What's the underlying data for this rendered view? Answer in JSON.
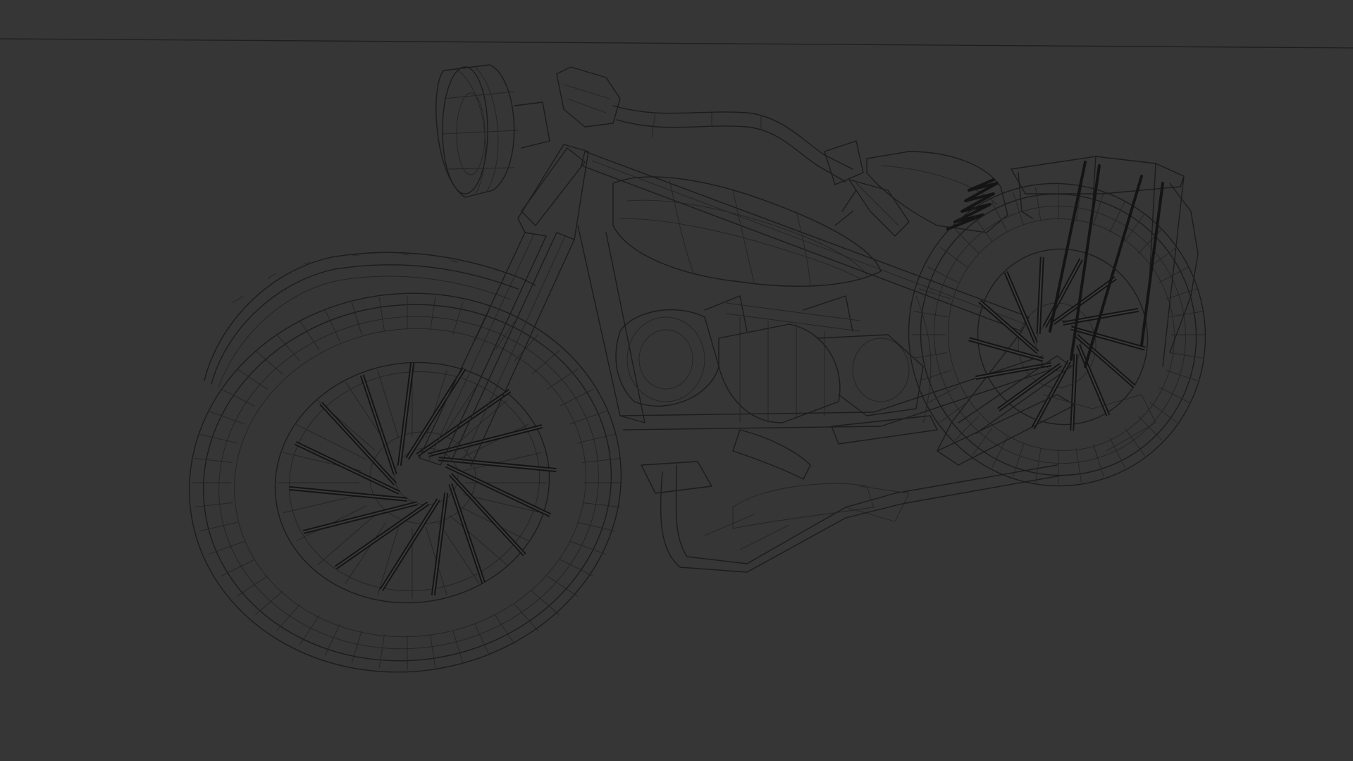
{
  "viewport": {
    "background": "#363636",
    "wire_color": "#1c1c1c",
    "shading_mode": "wireframe",
    "subject": "motorcycle-model",
    "wheel_spokes_front": 16,
    "wheel_spokes_rear": 14
  }
}
